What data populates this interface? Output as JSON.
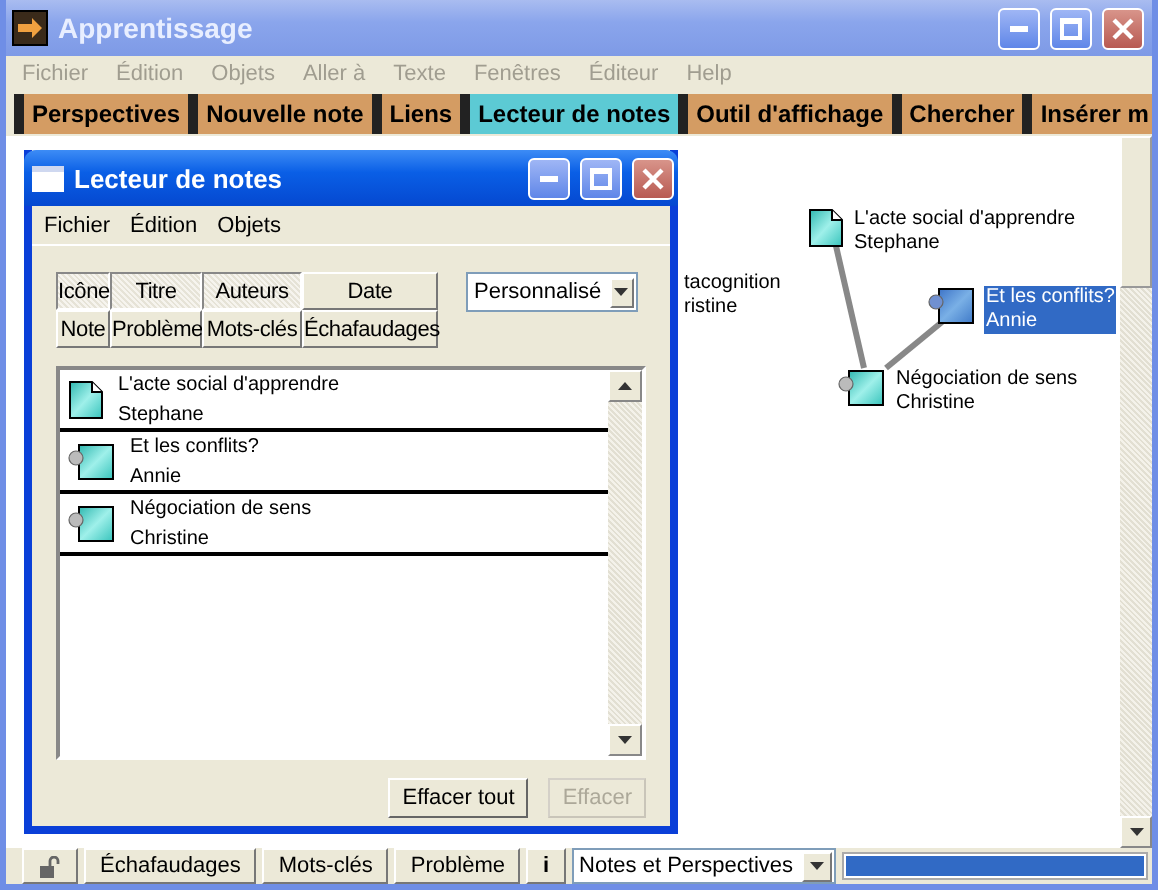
{
  "window": {
    "title": "Apprentissage"
  },
  "menu": [
    {
      "label": "Fichier",
      "disabled": true
    },
    {
      "label": "Édition",
      "disabled": true
    },
    {
      "label": "Objets",
      "disabled": true
    },
    {
      "label": "Aller à",
      "disabled": true
    },
    {
      "label": "Texte",
      "disabled": true
    },
    {
      "label": "Fenêtres",
      "disabled": true
    },
    {
      "label": "Éditeur",
      "disabled": true
    },
    {
      "label": "Help",
      "disabled": true
    }
  ],
  "toolbar": [
    {
      "label": "Perspectives",
      "selected": false
    },
    {
      "label": "Nouvelle note",
      "selected": false
    },
    {
      "label": "Liens",
      "selected": false
    },
    {
      "label": "Lecteur de notes",
      "selected": true
    },
    {
      "label": "Outil d'affichage",
      "selected": false
    },
    {
      "label": "Chercher",
      "selected": false
    },
    {
      "label": "Insérer m",
      "selected": false
    }
  ],
  "canvas": {
    "nodes": [
      {
        "title": "tacognition",
        "author": "ristine",
        "kind": "clipped",
        "selected": false
      },
      {
        "title": "L'acte social d'apprendre",
        "author": "Stephane",
        "kind": "document",
        "selected": false
      },
      {
        "title": "Et les conflits?",
        "author": "Annie",
        "kind": "linked",
        "selected": true
      },
      {
        "title": "Négociation de sens",
        "author": "Christine",
        "kind": "linked",
        "selected": false
      }
    ]
  },
  "reader": {
    "title": "Lecteur de notes",
    "menu": [
      "Fichier",
      "Édition",
      "Objets"
    ],
    "columns": [
      {
        "label": "Icône",
        "selected": true
      },
      {
        "label": "Titre",
        "selected": true
      },
      {
        "label": "Auteurs",
        "selected": true
      },
      {
        "label": "Date",
        "selected": false
      },
      {
        "label": "Note",
        "selected": false
      },
      {
        "label": "Problème",
        "selected": false
      },
      {
        "label": "Mots-clés",
        "selected": false
      },
      {
        "label": "Échafaudages",
        "selected": false
      }
    ],
    "view_select": {
      "value": "Personnalisé"
    },
    "notes": [
      {
        "title": "L'acte social d'apprendre",
        "author": "Stephane",
        "kind": "document"
      },
      {
        "title": "Et les conflits?",
        "author": "Annie",
        "kind": "linked"
      },
      {
        "title": "Négociation de sens",
        "author": "Christine",
        "kind": "linked"
      }
    ],
    "buttons": [
      {
        "label": "Effacer tout",
        "disabled": false
      },
      {
        "label": "Effacer",
        "disabled": true
      }
    ]
  },
  "status_bar": {
    "tabs": [
      "Échafaudages",
      "Mots-clés",
      "Problème"
    ],
    "info": "i",
    "perspective_select": {
      "value": "Notes et Perspectives"
    },
    "progress": {
      "level": 1
    }
  }
}
